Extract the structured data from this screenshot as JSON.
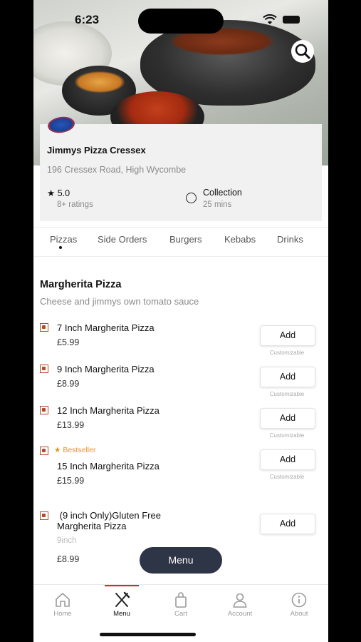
{
  "status": {
    "time": "6:23"
  },
  "restaurant": {
    "name": "Jimmys Pizza Cressex",
    "address": "196 Cressex Road, High Wycombe",
    "rating": "5.0",
    "rating_count": "8+ ratings",
    "mode": "Collection",
    "time": "25 mins"
  },
  "categories": [
    "Pizzas",
    "Side Orders",
    "Burgers",
    "Kebabs",
    "Drinks"
  ],
  "section": {
    "title": "Margherita Pizza",
    "description": "Cheese and jimmys own tomato sauce"
  },
  "items": [
    {
      "name": "7 Inch Margherita Pizza",
      "price": "£5.99",
      "add": "Add",
      "note": "Customizable"
    },
    {
      "name": "9 Inch Margherita Pizza",
      "price": "£8.99",
      "add": "Add",
      "note": "Customizable"
    },
    {
      "name": "12 Inch Margherita Pizza",
      "price": "£13.99",
      "add": "Add",
      "note": "Customizable"
    },
    {
      "badge": "Bestseller",
      "name": "15 Inch Margherita Pizza",
      "price": "£15.99",
      "add": "Add",
      "note": "Customizable"
    },
    {
      "name_line1": " (9 inch Only)Gluten Free",
      "name_line2": "Margherita Pizza",
      "sub": "9inch",
      "price": "£8.99",
      "add": "Add"
    }
  ],
  "menu_button": "Menu",
  "nav": [
    {
      "label": "Home",
      "icon": "home-icon"
    },
    {
      "label": "Menu",
      "icon": "cutlery-icon"
    },
    {
      "label": "Cart",
      "icon": "bag-icon"
    },
    {
      "label": "Account",
      "icon": "user-icon"
    },
    {
      "label": "About",
      "icon": "info-icon"
    }
  ],
  "colors": {
    "accent": "#d02a2a",
    "bestseller": "#e8941a",
    "veg": "#b34a2a",
    "fab": "#2e3546"
  }
}
